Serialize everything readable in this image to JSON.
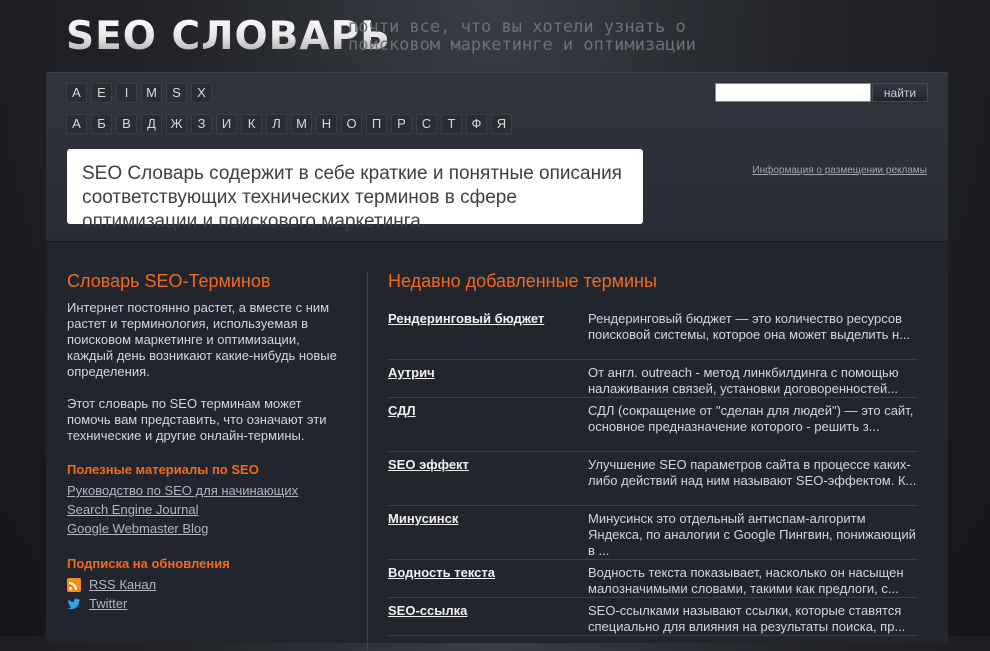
{
  "header": {
    "title": "SEO СЛОВАРЬ",
    "tagline": "почти все, что вы хотели узнать о поисковом маркетинге и оптимизации"
  },
  "alphabet": {
    "latin": [
      "A",
      "E",
      "I",
      "M",
      "S",
      "X"
    ],
    "cyrillic": [
      "А",
      "Б",
      "В",
      "Д",
      "Ж",
      "З",
      "И",
      "К",
      "Л",
      "М",
      "Н",
      "О",
      "П",
      "Р",
      "С",
      "Т",
      "Ф",
      "Я"
    ]
  },
  "search": {
    "value": "",
    "button_label": "найти"
  },
  "intro": {
    "text": "SEO Словарь содержит в себе краткие и понятные описания соответствующих технических терминов в сфере оптимизации и поискового маркетинга."
  },
  "ad_link": "Информация о размещении рекламы",
  "left": {
    "heading": "Словарь SEO-Терминов",
    "para1": "Интернет постоянно растет, а вместе с ним растет и терминология, используемая в поисковом маркетинге и оптимизации, каждый день возникают какие-нибудь новые определения.",
    "para2": "Этот словарь по SEO терминам может помочь вам представить, что означают эти технические и другие онлайн-термины.",
    "materials_heading": "Полезные материалы по SEO",
    "materials": [
      "Руководство по SEO для начинающих",
      "Search Engine Journal",
      "Google Webmaster Blog"
    ],
    "subscribe_heading": "Подписка на обновления",
    "rss_label": "RSS Канал",
    "twitter_label": "Twitter"
  },
  "right": {
    "heading": "Недавно добавленные термины",
    "terms": [
      {
        "name": "Рендеринговый бюджет",
        "desc": "Рендеринговый бюджет — это количество ресурсов поисковой системы, которое она может выделить н..."
      },
      {
        "name": "Аутрич",
        "desc": "От англ. outreach - метод линкбилдинга с помощью налаживания связей, установки договоренностей..."
      },
      {
        "name": "СДЛ",
        "desc": "СДЛ (сокращение от \"сделан для людей\") — это сайт, основное предназначение которого - решить з..."
      },
      {
        "name": "SEO эффект",
        "desc": "Улучшение SEO параметров сайта в процессе каких-либо действий над ним называют SEO-эффектом. К..."
      },
      {
        "name": "Минусинск",
        "desc": "Минусинск это отдельный антиспам-алгоритм Яндекса, по аналогии с Google Пингвин, понижающий в ..."
      },
      {
        "name": "Водность текста",
        "desc": "Водность текста показывает, насколько он насыщен малозначимыми словами, такими как предлоги, с..."
      },
      {
        "name": "SEO-ссылка",
        "desc": "SEO-ссылками называют ссылки, которые ставятся специально для влияния на результаты поиска, пр..."
      }
    ]
  },
  "colors": {
    "accent": "#ef6b22",
    "background": "#22252d",
    "rss": "#f58a1f",
    "twitter": "#2fa7e0"
  }
}
